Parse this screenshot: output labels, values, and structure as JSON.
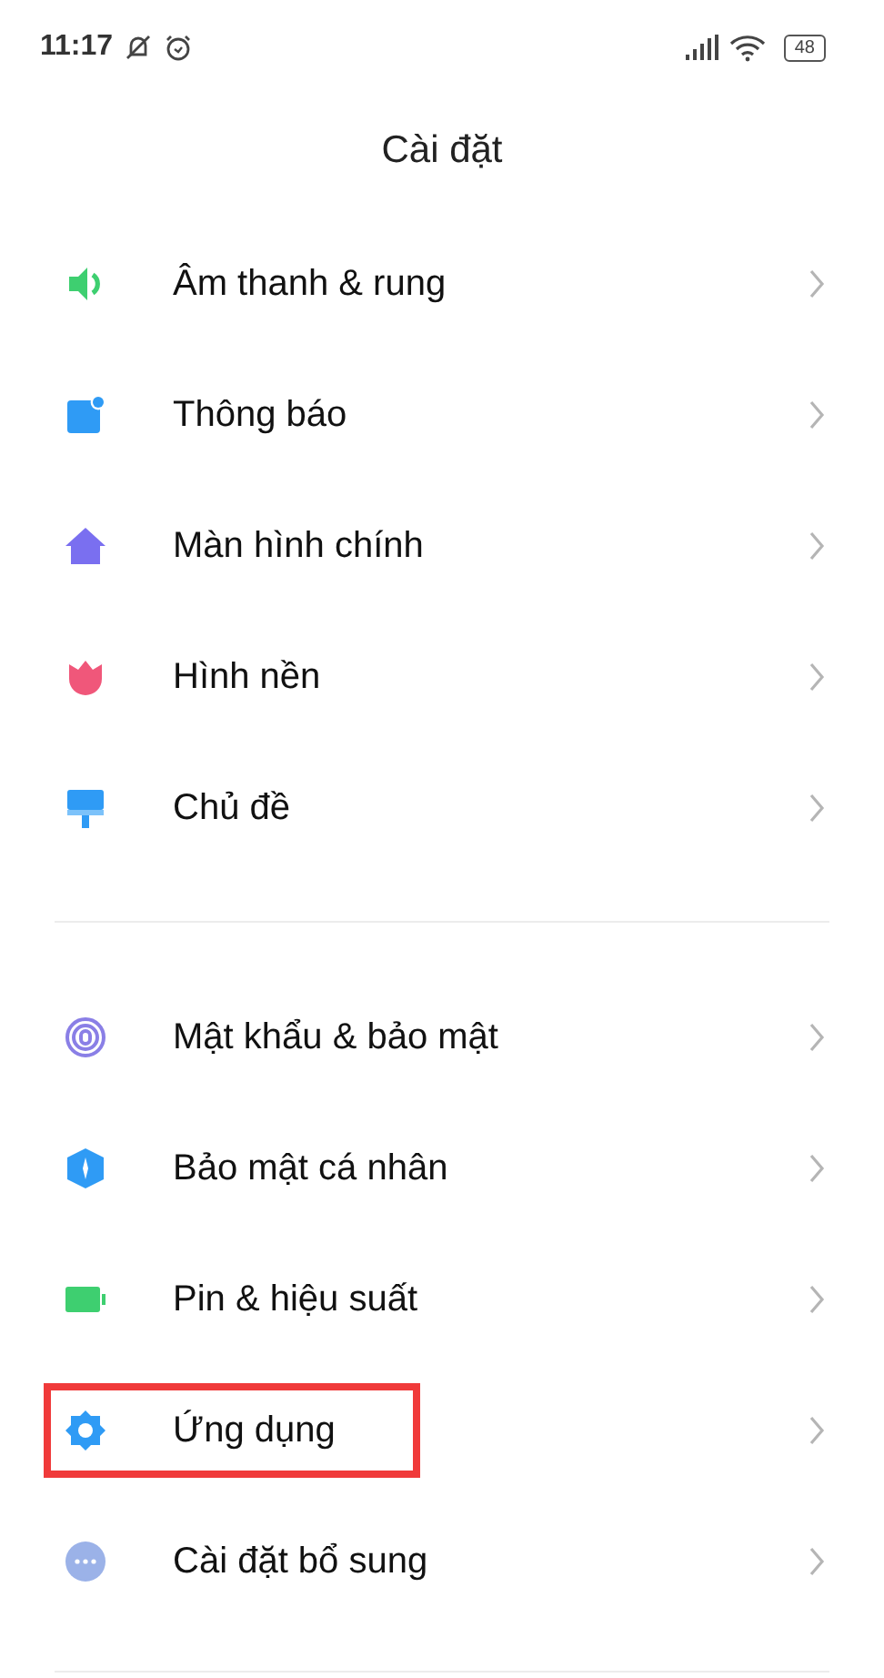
{
  "status_bar": {
    "time": "11:17",
    "battery": "48"
  },
  "title": "Cài đặt",
  "groups": [
    {
      "items": [
        {
          "label": "Âm thanh & rung",
          "highlighted": false
        },
        {
          "label": "Thông báo",
          "highlighted": false
        },
        {
          "label": "Màn hình chính",
          "highlighted": false
        },
        {
          "label": "Hình nền",
          "highlighted": false
        },
        {
          "label": "Chủ đề",
          "highlighted": false
        }
      ]
    },
    {
      "items": [
        {
          "label": "Mật khẩu & bảo mật",
          "highlighted": false
        },
        {
          "label": "Bảo mật cá nhân",
          "highlighted": false
        },
        {
          "label": "Pin & hiệu suất",
          "highlighted": false
        },
        {
          "label": "Ứng dụng",
          "highlighted": true
        },
        {
          "label": "Cài đặt bổ sung",
          "highlighted": false
        }
      ]
    }
  ]
}
